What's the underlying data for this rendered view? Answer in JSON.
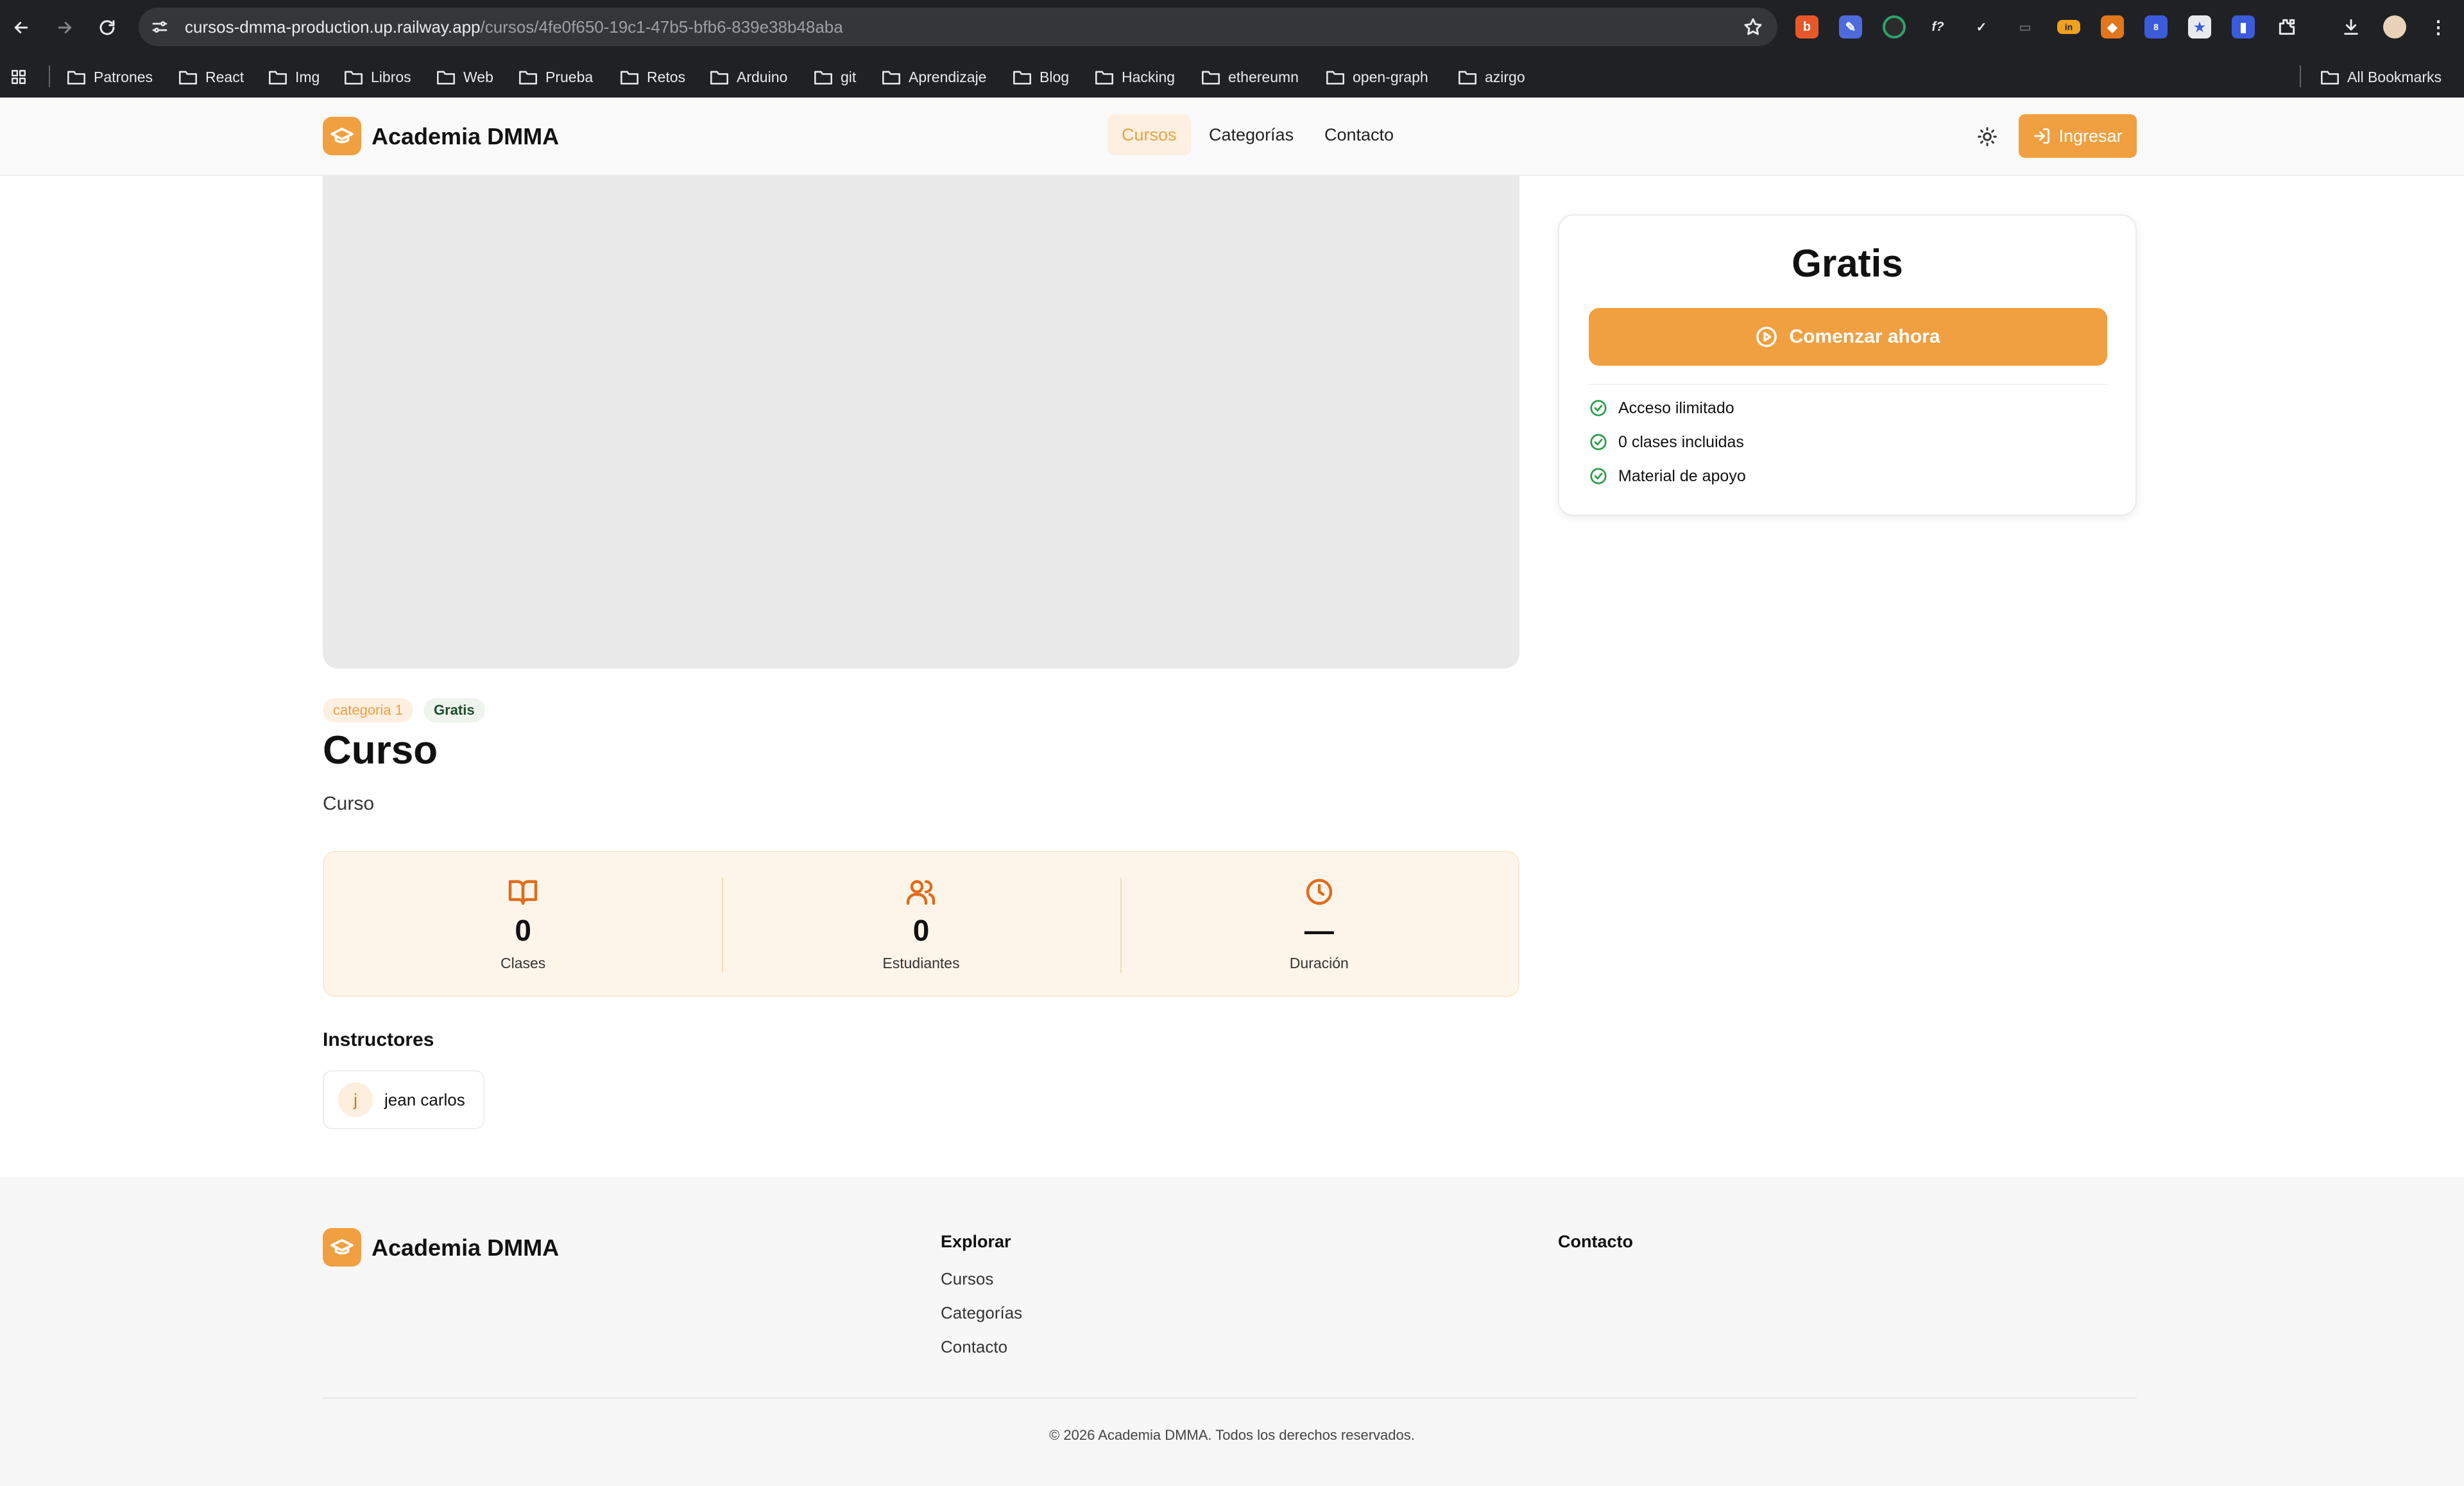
{
  "browser": {
    "url_host": "cursos-dmma-production.up.railway.app",
    "url_path": "/cursos/4fe0f650-19c1-47b5-bfb6-839e38b48aba",
    "extension_badge": "8",
    "bookmarks": [
      "Patrones",
      "React",
      "Img",
      "Libros",
      "Web",
      "Prueba",
      "Retos",
      "Arduino",
      "git",
      "Aprendizaje",
      "Blog",
      "Hacking",
      "ethereumn",
      "open-graph",
      "azirgo"
    ],
    "all_bookmarks_label": "All Bookmarks"
  },
  "header": {
    "brand": "Academia DMMA",
    "nav": [
      "Cursos",
      "Categorías",
      "Contacto"
    ],
    "active_nav": "Cursos",
    "login_label": "Ingresar",
    "accent_color": "#f0a040"
  },
  "course": {
    "category_tag": "categoria 1",
    "price_tag": "Gratis",
    "title": "Curso",
    "description": "Curso",
    "stats": [
      {
        "icon": "book-open-icon",
        "value": "0",
        "label": "Clases"
      },
      {
        "icon": "users-icon",
        "value": "0",
        "label": "Estudiantes"
      },
      {
        "icon": "clock-icon",
        "value": "—",
        "label": "Duración"
      }
    ],
    "instructors_heading": "Instructores",
    "instructor": {
      "initial": "j",
      "name": "jean carlos"
    }
  },
  "price_card": {
    "price": "Gratis",
    "cta_label": "Comenzar ahora",
    "features": [
      "Acceso ilimitado",
      "0 clases incluidas",
      "Material de apoyo"
    ]
  },
  "footer": {
    "brand": "Academia DMMA",
    "explore_title": "Explorar",
    "explore_links": [
      "Cursos",
      "Categorías",
      "Contacto"
    ],
    "contact_title": "Contacto",
    "copyright": "© 2026 Academia DMMA. Todos los derechos reservados."
  }
}
